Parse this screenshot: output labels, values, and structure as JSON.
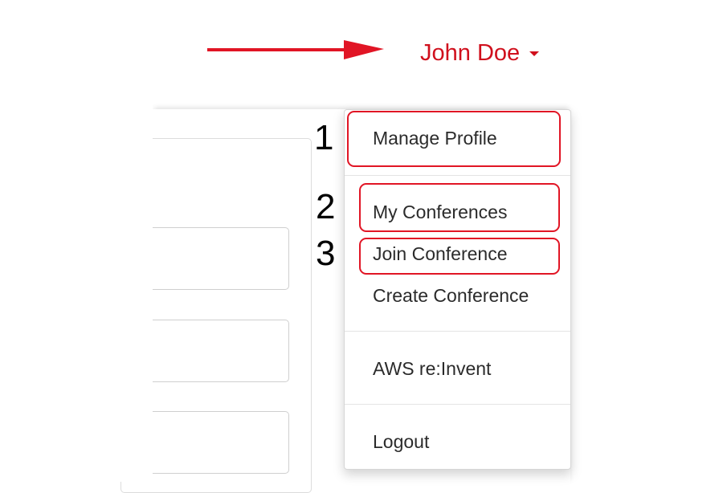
{
  "user": {
    "name": "John Doe"
  },
  "menu": {
    "items": [
      {
        "label": "Manage Profile"
      },
      {
        "label": "My Conferences"
      },
      {
        "label": "Join Conference"
      },
      {
        "label": "Create Conference"
      },
      {
        "label": "AWS re:Invent"
      },
      {
        "label": "Logout"
      }
    ]
  },
  "annotations": {
    "numbers": [
      "1",
      "2",
      "3"
    ],
    "color": "#e11525"
  },
  "colors": {
    "accent": "#d0101d",
    "text": "#2b2b2b"
  },
  "icons": {
    "caret": "caret-down-icon",
    "arrow": "arrow-right-icon"
  }
}
